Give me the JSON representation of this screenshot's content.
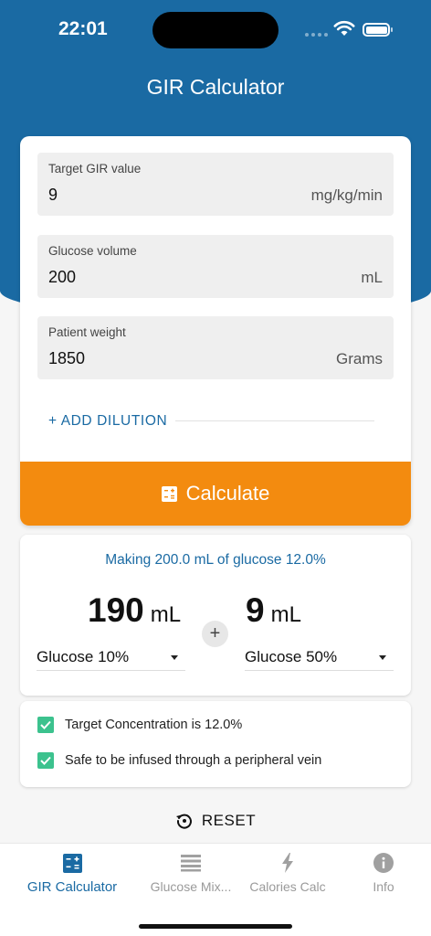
{
  "status_bar": {
    "time": "22:01"
  },
  "header": {
    "title": "GIR Calculator"
  },
  "form": {
    "gir": {
      "label": "Target GIR value",
      "value": "9",
      "unit": "mg/kg/min"
    },
    "glucose_volume": {
      "label": "Glucose volume",
      "value": "200",
      "unit": "mL"
    },
    "weight": {
      "label": "Patient weight",
      "value": "1850",
      "unit": "Grams"
    },
    "add_dilution_label": "+ ADD DILUTION",
    "calculate_label": "Calculate"
  },
  "result": {
    "making_text": "Making 200.0 mL of glucose 12.0%",
    "left": {
      "amount": "190",
      "unit": "mL",
      "solution": "Glucose 10%"
    },
    "right": {
      "amount": "9",
      "unit": "mL",
      "solution": "Glucose 50%"
    },
    "plus": "+"
  },
  "checks": [
    {
      "text": "Target Concentration is 12.0%",
      "checked": true
    },
    {
      "text": "Safe to be infused through a peripheral vein",
      "checked": true
    }
  ],
  "reset_label": "RESET",
  "nav": [
    {
      "label": "GIR Calculator",
      "icon": "calculator-icon",
      "active": true
    },
    {
      "label": "Glucose Mix...",
      "icon": "list-icon",
      "active": false
    },
    {
      "label": "Calories Calc",
      "icon": "lightning-icon",
      "active": false
    },
    {
      "label": "Info",
      "icon": "info-icon",
      "active": false
    }
  ],
  "colors": {
    "primary": "#1a6aa3",
    "accent": "#f38b0f",
    "check": "#3cc28e"
  }
}
